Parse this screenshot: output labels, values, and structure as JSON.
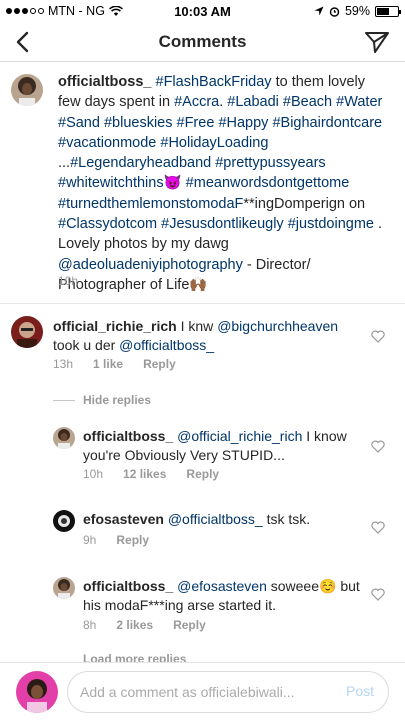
{
  "status_bar": {
    "carrier": "MTN - NG",
    "time": "10:03 AM",
    "battery": "59%",
    "battery_level": 0.59
  },
  "header": {
    "title": "Comments"
  },
  "caption": {
    "username": "officialtboss_",
    "text_html": "#FlashBackFriday to them lovely few days spent in #Accra. #Labadi #Beach #Water #Sand #blueskies #Free #Happy #Bighairdontcare #vacationmode #HolidayLoading ...#Legendaryheadband #prettypussyears #whitewitchthins😈 #meanwordsdontgettome #turnedthemlemonstomodaF**ingDomperign on #Classydotcom  #Jesusdontlikeugly #justdoingme . Lovely photos by my dawg @adeoluadeniyiphotography - Director/ Photographer of Life🙌🏾",
    "time": "10h"
  },
  "comments": [
    {
      "username": "official_richie_rich",
      "mention": "",
      "text": "I knw @bigchurchheaven took u der @officialtboss_",
      "time": "13h",
      "likes": "1 like",
      "reply": "Reply"
    },
    {
      "username": "officialtboss_",
      "text": "@official_richie_rich I know you're Obviously Very STUPID...",
      "time": "10h",
      "likes": "12 likes",
      "reply": "Reply"
    },
    {
      "username": "efosasteven",
      "text": "@officialtboss_ tsk tsk.",
      "time": "9h",
      "likes": "",
      "reply": "Reply"
    },
    {
      "username": "officialtboss_",
      "text": "@efosasteven soweee☺️ but his modaF***ing arse started it.",
      "time": "8h",
      "likes": "2 likes",
      "reply": "Reply"
    }
  ],
  "hide_replies": "Hide replies",
  "load_more": "Load more replies",
  "input": {
    "placeholder": "Add a comment as officialebiwali...",
    "post_label": "Post"
  },
  "icons": {
    "back": "back-arrow-icon",
    "send": "direct-send-icon",
    "heart": "heart-outline-icon"
  }
}
